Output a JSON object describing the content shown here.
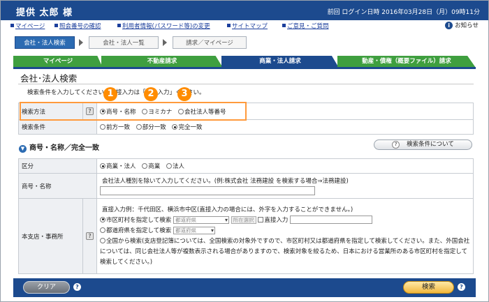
{
  "header": {
    "user_name": "提供 太郎 様",
    "last_login": "前回 ログイン日時 2016年03月28日（月）09時11分"
  },
  "links": {
    "mypage": "マイページ",
    "ref_number": "照会番号の確認",
    "user_info": "利用者情報(パスワード等)の変更",
    "sitemap": "サイトマップ",
    "feedback": "ご意見・ご質問",
    "notice": "お知らせ",
    "notice_icon": "info-icon"
  },
  "steps": [
    "会社・法人検索",
    "会社・法人一覧",
    "請求／マイページ"
  ],
  "tabs": [
    {
      "label": "マイページ",
      "color": "#3f9f3f"
    },
    {
      "label": "不動産請求",
      "color": "#3f9f3f"
    },
    {
      "label": "商業・法人請求",
      "color": "#1c4a8e"
    },
    {
      "label": "動産・債権（概要ファイル）請求",
      "color": "#3f9f3f"
    }
  ],
  "page": {
    "title": "会社･法人検索",
    "instruction": "検索条件を入力してください。直接入力は「同一入力」ください。",
    "badges": [
      "1",
      "2",
      "3"
    ]
  },
  "form1": {
    "method_label": "検索方法",
    "method_options": [
      "商号・名称",
      "ヨミカナ",
      "会社法人等番号"
    ],
    "condition_label": "検索条件",
    "condition_options": [
      "前方一致",
      "部分一致",
      "完全一致"
    ],
    "help": "?"
  },
  "section": {
    "title": "商号・名称／完全一致",
    "cond_button": "検索条件について"
  },
  "form2": {
    "kubun_label": "区分",
    "kubun_options": [
      "商業・法人",
      "商業",
      "法人"
    ],
    "name_label": "商号・名称",
    "name_note": "会社法人種別を除いて入力してください。(例:株式会社 法務建設 を検索する場合⇒法務建設)",
    "name_value": "",
    "office_label": "本支店・事務所",
    "office_help": "?",
    "office_note": "直接入力例：千代田区、横浜市中区(直接入力の場合には、外字を入力することができません。)",
    "opt_city": "市区町村を指定して検索",
    "pref_select": "都道府県",
    "city_select_btn": "所在選択",
    "direct_input": "直接入力",
    "opt_pref": "都道府県を指定して検索",
    "pref_select2": "都道府県",
    "opt_all": "全国から検索",
    "all_note": "(支店登記簿については、全国検索の対象外ですので、市区町村又は都道府県を指定して検索してください。また、外国会社については、同じ会社法人等が複数表示される場合がありますので、検索対象を絞るため、日本における営業所のある市区町村を指定して検索してください。)"
  },
  "buttons": {
    "clear": "クリア",
    "search": "検索",
    "help": "?"
  }
}
